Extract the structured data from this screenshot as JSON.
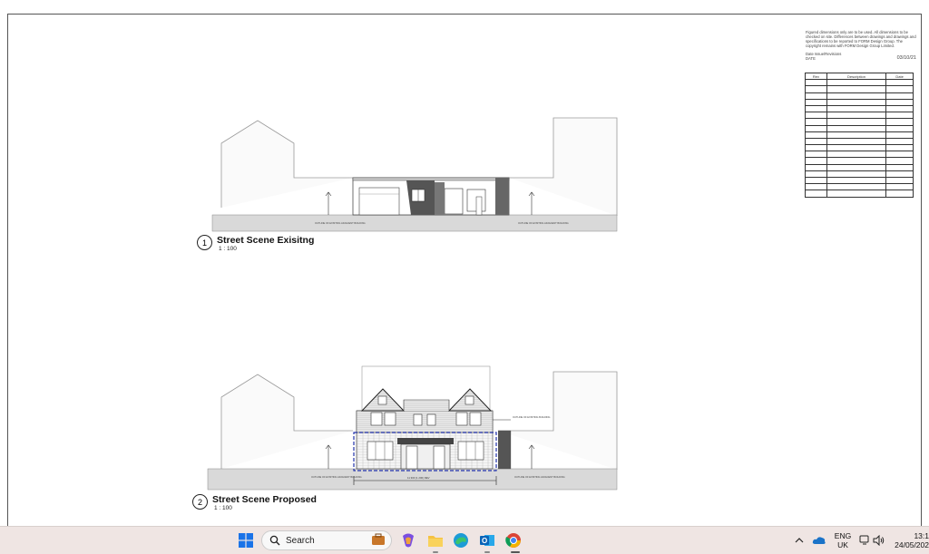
{
  "drawing": {
    "notes": "Figured dimensions only are to be used. All dimensions to be checked on site. Differences between drawings and drawings and specifications to be reported to FORM Design Group. The copyright remains with FORM Design Group Limited.",
    "date_issue_label": "Date Issue/Revisions",
    "date_label": "DATE",
    "date_value": "03/10/21",
    "revision_headers": [
      "Rev",
      "Description",
      "Date"
    ],
    "views": [
      {
        "number": "1",
        "title": "Street Scene Exisitng",
        "scale": "1 : 100"
      },
      {
        "number": "2",
        "title": "Street Scene Proposed",
        "scale": "1 : 100"
      }
    ],
    "annotations": {
      "outline_left": "OUTLINE OF EXISTING ADJACENT BUILDING",
      "outline_right": "OUTLINE OF EXISTING ADJACENT BUILDING",
      "outline_existing": "OUTLINE OF EXISTING BUILDING",
      "dimension": "11 300 (1 200) REV"
    }
  },
  "taskbar": {
    "search_placeholder": "Search",
    "language": "ENG",
    "region": "UK",
    "time": "13:1",
    "date": "24/05/202"
  }
}
